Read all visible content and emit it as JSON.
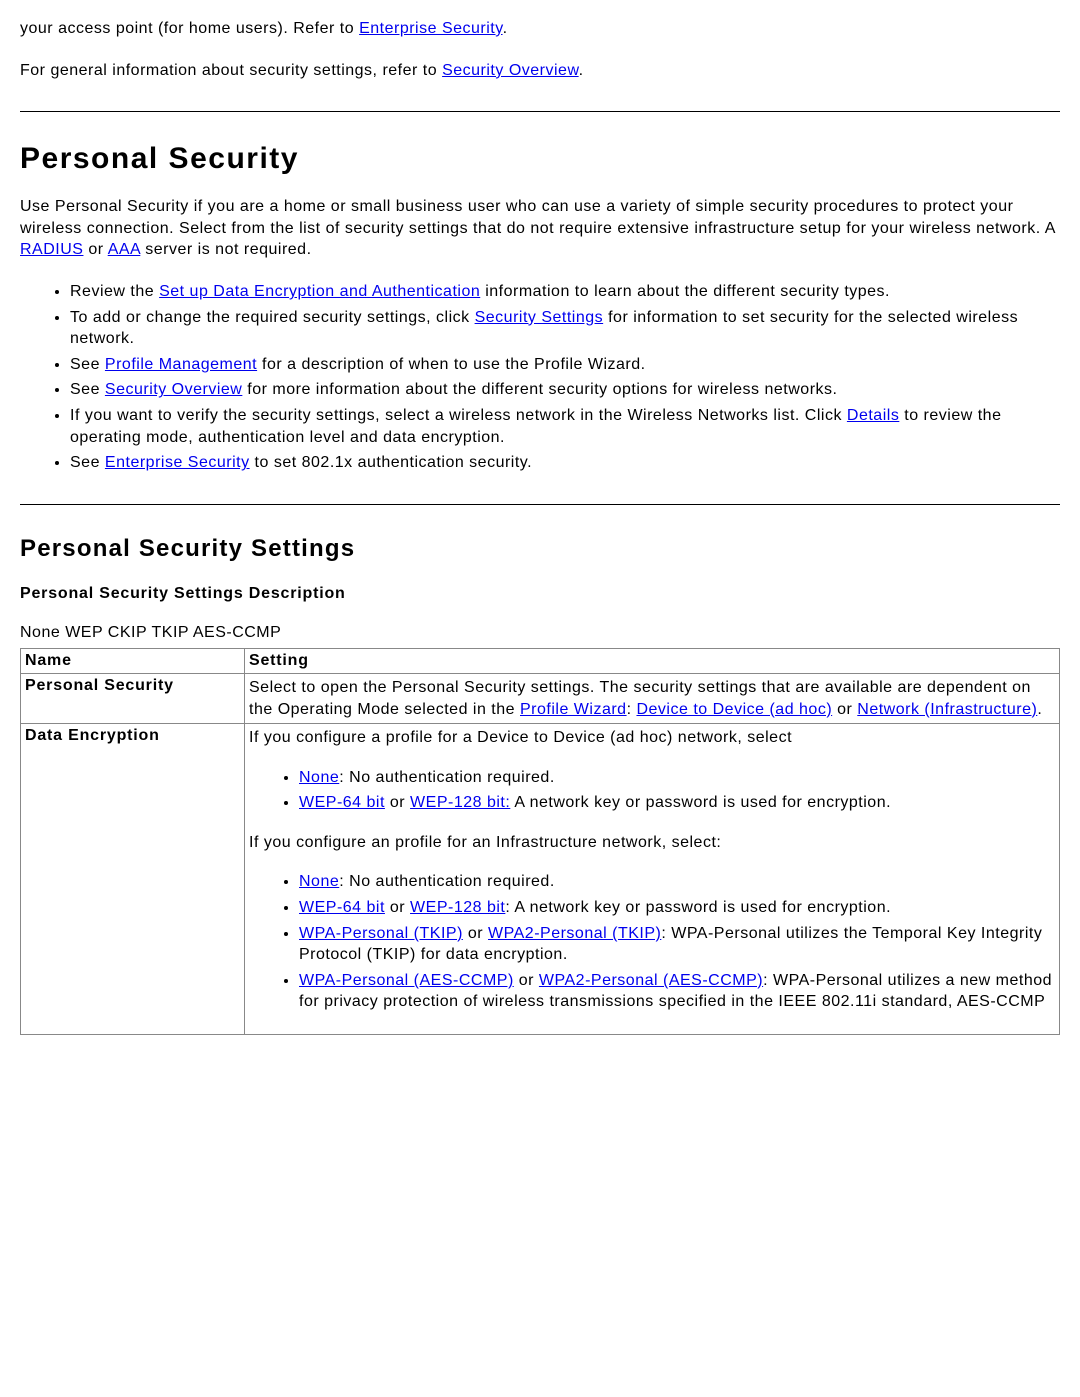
{
  "intro": {
    "p1_pre": "your access point (for home users). Refer to ",
    "link_enterprise": "Enterprise Security",
    "p1_post": ".",
    "p2_pre": "For general information about security settings, refer to ",
    "link_overview": "Security Overview",
    "p2_post": "."
  },
  "h2": "Personal Security",
  "personal_p": {
    "t1": "Use Personal Security if you are a home or small business user who can use a variety of simple security procedures to protect your wireless connection. Select from the list of security settings that do not require extensive infrastructure setup for your wireless network. A ",
    "radius": "RADIUS",
    "t2": " or ",
    "aaa": "AAA",
    "t3": " server is not required."
  },
  "bul": {
    "b1a": "Review the ",
    "b1link": "Set up Data Encryption and Authentication",
    "b1b": " information to learn about the different security types.",
    "b2a": "To add or change the required security settings, click ",
    "b2link": "Security Settings",
    "b2b": " for information to set security for the selected wireless network.",
    "b3a": "See ",
    "b3link": "Profile Management",
    "b3b": " for a description of when to use the Profile Wizard.",
    "b4a": "See ",
    "b4link": "Security Overview",
    "b4b": " for more information about the different security options for wireless networks.",
    "b5a": "If you want to verify the security settings, select a wireless network in the Wireless Networks list. Click ",
    "b5link": "Details",
    "b5b": " to review the operating mode, authentication level and data encryption.",
    "b6a": "See ",
    "b6link": "Enterprise Security",
    "b6b": " to set 802.1x authentication security."
  },
  "h3": "Personal Security Settings",
  "table_caption": "Personal Security Settings Description",
  "table_sub": "None WEP CKIP TKIP AES-CCMP",
  "th_name": "Name",
  "th_setting": "Setting",
  "row1": {
    "name": "Personal Security",
    "t1": "Select to open the Personal Security settings. The security settings that are available are dependent on the Operating Mode selected in the ",
    "link1": "Profile Wizard",
    "sep1": ": ",
    "link2": "Device to Device (ad hoc)",
    "t2": " or ",
    "link3": "Network (Infrastructure)",
    "t3": "."
  },
  "row2": {
    "name": "Data Encryption",
    "lead": "If you configure a profile for a Device to Device (ad hoc) network, select",
    "ad1_link": "None",
    "ad1_text": ": No authentication required.",
    "ad2_link1": "WEP-64 bit",
    "ad2_mid": " or ",
    "ad2_link2": "WEP-128 bit:",
    "ad2_text": " A network key or password is used for encryption.",
    "lead2": "If you configure an profile for an Infrastructure network, select:",
    "in1_link": "None",
    "in1_text": ": No authentication required.",
    "in2_link1": "WEP-64 bit",
    "in2_mid": " or ",
    "in2_link2": "WEP-128 bit",
    "in2_text": ": A network key or password is used for encryption.",
    "in3_link1": "WPA-Personal (TKIP)",
    "in3_mid": " or ",
    "in3_link2": "WPA2-Personal (TKIP)",
    "in3_text": ": WPA-Personal utilizes the Temporal Key Integrity Protocol (TKIP) for data encryption.",
    "in4_link1": "WPA-Personal (AES-CCMP)",
    "in4_mid": " or ",
    "in4_link2": "WPA2-Personal (AES-CCMP)",
    "in4_text": ": WPA-Personal utilizes a new method for privacy protection of wireless transmissions specified in the IEEE 802.11i standard, AES-CCMP"
  }
}
